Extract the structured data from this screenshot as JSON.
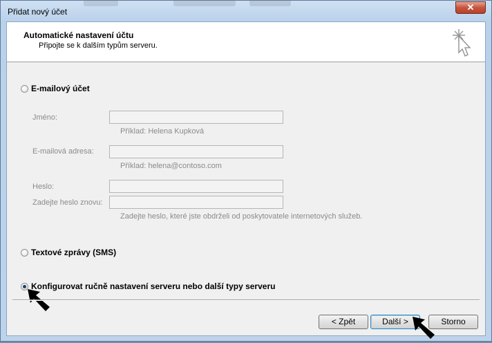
{
  "window": {
    "title": "Přidat nový účet",
    "close_glyph": "✕"
  },
  "header": {
    "title": "Automatické nastavení účtu",
    "subtitle": "Připojte se k dalším typům serveru."
  },
  "options": {
    "email": {
      "label": "E-mailový účet",
      "selected": false
    },
    "sms": {
      "label": "Textové zprávy (SMS)",
      "selected": false
    },
    "manual": {
      "label": "Konfigurovat ručně nastavení serveru nebo další typy serveru",
      "selected": true
    }
  },
  "form": {
    "name_label": "Jméno:",
    "name_value": "",
    "name_hint": "Příklad: Helena Kupková",
    "email_label": "E-mailová adresa:",
    "email_value": "",
    "email_hint": "Příklad: helena@contoso.com",
    "password_label": "Heslo:",
    "password_value": "",
    "password2_label": "Zadejte heslo znovu:",
    "password2_value": "",
    "password_hint": "Zadejte heslo, které jste obdrželi od poskytovatele internetových služeb."
  },
  "buttons": {
    "back": "< Zpět",
    "next": "Další >",
    "cancel": "Storno"
  },
  "icons": {
    "wizard": "wizard-cursor-icon",
    "pointer": "black-arrow-pointer-icon"
  }
}
